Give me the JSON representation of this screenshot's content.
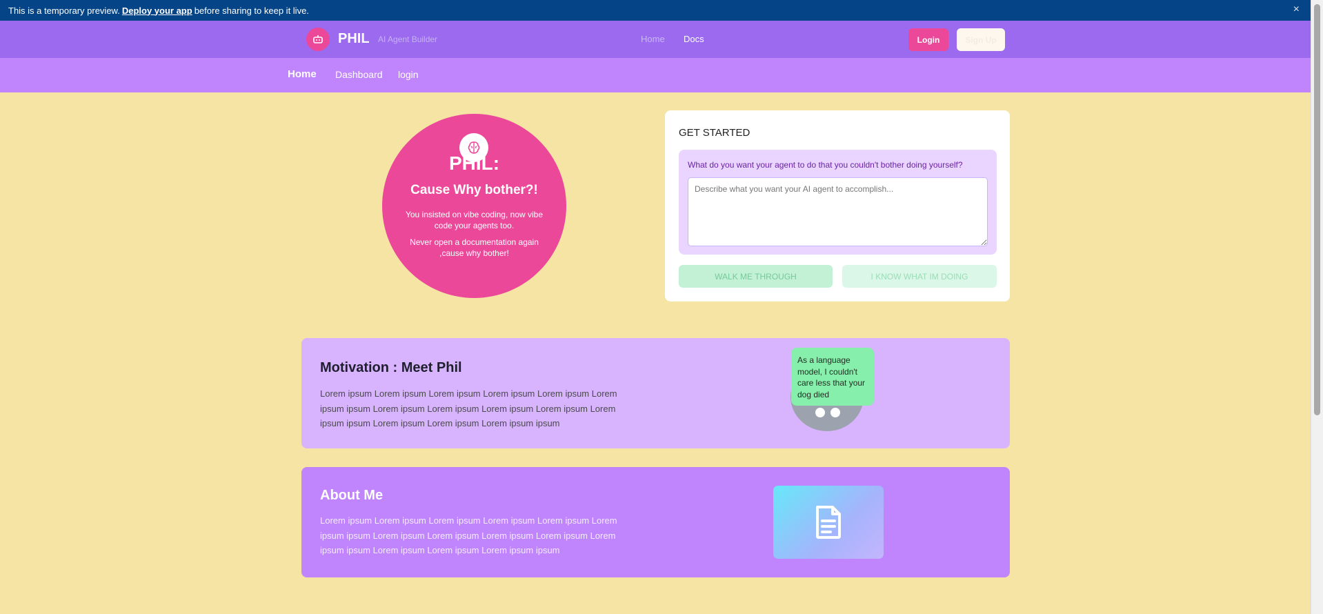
{
  "banner": {
    "text_before": "This is a temporary preview.",
    "link_text": "Deploy your app",
    "text_after": "before sharing to keep it live.",
    "close_glyph": "×"
  },
  "header": {
    "logo_icon": "robot-icon",
    "brand": "PHIL",
    "tagline": "AI Agent Builder",
    "nav": {
      "home": "Home",
      "docs": "Docs"
    },
    "login_label": "Login",
    "signup_label": "Sign Up",
    "colors": {
      "bar": "#9b6aef",
      "accent": "#ec4899"
    }
  },
  "subnav": {
    "items": [
      {
        "label": "Home"
      },
      {
        "label": "Dashboard"
      },
      {
        "label": "login"
      }
    ]
  },
  "hero": {
    "icon": "brain-icon",
    "title": "PHIL:",
    "subtitle": "Cause Why bother?!",
    "line1": "You insisted on vibe coding, now vibe code your agents too.",
    "line2": "Never open a documentation again ,cause why bother!"
  },
  "get_started": {
    "title": "GET STARTED",
    "question": "What do you want your agent to do that you couldn't bother doing yourself?",
    "placeholder": "Describe what you want your AI agent to accomplish...",
    "walk_label": "WALK ME THROUGH",
    "know_label": "I KNOW WHAT IM DOING"
  },
  "motivation": {
    "title": "Motivation : Meet Phil",
    "body": "Lorem ipsum Lorem ipsum Lorem ipsum Lorem ipsum Lorem ipsum Lorem ipsum ipsum Lorem ipsum Lorem ipsum Lorem ipsum Lorem ipsum Lorem ipsum ipsum Lorem ipsum Lorem ipsum Lorem ipsum ipsum",
    "speech": "As a language model, I couldn't care less that your dog died"
  },
  "about": {
    "title": "About Me",
    "body": "Lorem ipsum Lorem ipsum Lorem ipsum Lorem ipsum Lorem ipsum Lorem ipsum ipsum Lorem ipsum Lorem ipsum Lorem ipsum Lorem ipsum Lorem ipsum ipsum Lorem ipsum Lorem ipsum Lorem ipsum ipsum",
    "icon": "document-icon"
  }
}
